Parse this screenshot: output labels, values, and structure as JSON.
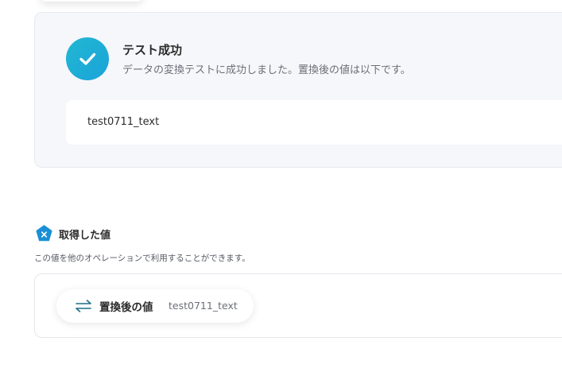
{
  "success": {
    "title": "テスト成功",
    "message": "データの変換テストに成功しました。置換後の値は以下です。",
    "result_value": "test0711_text"
  },
  "acquired": {
    "title": "取得した値",
    "description": "この値を他のオペレーションで利用することができます。",
    "items": [
      {
        "label": "置換後の値",
        "value": "test0711_text"
      }
    ]
  },
  "colors": {
    "accent": "#1aa3d9",
    "card_bg": "#f5f7fa",
    "text": "#2b2b2b"
  },
  "icons": {
    "success": "check-icon",
    "acquired": "variable-icon",
    "chip": "swap-arrows-icon"
  }
}
